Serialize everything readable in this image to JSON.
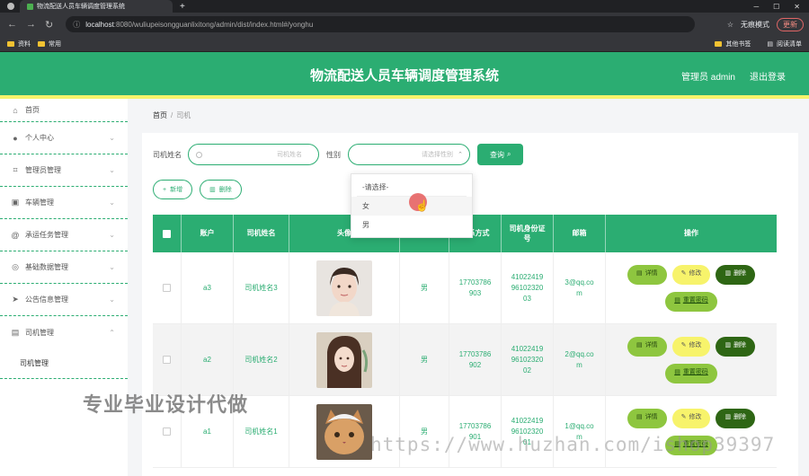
{
  "browser": {
    "tab_title": "物流配送人员车辆调度管理系统",
    "url_host": "localhost",
    "url_rest": ":8080/wuliupeisongguanlixitong/admin/dist/index.html#/yonghu",
    "incognito": "无痕模式",
    "update": "更新",
    "bookmarks": [
      "资料",
      "常用"
    ],
    "bookmarks_right": [
      "其他书签",
      "阅读清单"
    ]
  },
  "header": {
    "title": "物流配送人员车辆调度管理系统",
    "admin": "管理员 admin",
    "logout": "退出登录"
  },
  "sidebar": {
    "items": [
      {
        "label": "首页",
        "icon": "home-icon"
      },
      {
        "label": "个人中心",
        "icon": "user-icon"
      },
      {
        "label": "管理员管理",
        "icon": "crop-icon"
      },
      {
        "label": "车辆管理",
        "icon": "car-icon"
      },
      {
        "label": "承运任务管理",
        "icon": "at-icon"
      },
      {
        "label": "基础数据管理",
        "icon": "compass-icon"
      },
      {
        "label": "公告信息管理",
        "icon": "send-icon"
      },
      {
        "label": "司机管理",
        "icon": "doc-icon"
      }
    ],
    "sub": "司机管理"
  },
  "breadcrumb": {
    "home": "首页",
    "sep": "/",
    "current": "司机"
  },
  "search": {
    "name_label": "司机姓名",
    "name_placeholder": "司机姓名",
    "gender_label": "性别",
    "gender_placeholder": "请选择性别",
    "query": "查询"
  },
  "actions": {
    "add": "新增",
    "delete": "删除"
  },
  "dropdown": [
    "-请选择-",
    "女",
    "男"
  ],
  "table": {
    "headers": [
      "账户",
      "司机姓名",
      "头像",
      "性别",
      "联系方式",
      "司机身份证号",
      "邮箱",
      "操作"
    ],
    "rows": [
      {
        "account": "a3",
        "name": "司机姓名3",
        "gender": "男",
        "phone1": "17703786",
        "phone2": "903",
        "id1": "41022419",
        "id2": "96102320",
        "id3": "03",
        "email1": "3@qq.co",
        "email2": "m"
      },
      {
        "account": "a2",
        "name": "司机姓名2",
        "gender": "男",
        "phone1": "17703786",
        "phone2": "902",
        "id1": "41022419",
        "id2": "96102320",
        "id3": "02",
        "email1": "2@qq.co",
        "email2": "m"
      },
      {
        "account": "a1",
        "name": "司机姓名1",
        "gender": "男",
        "phone1": "17703786",
        "phone2": "901",
        "id1": "41022419",
        "id2": "96102320",
        "id3": "01",
        "email1": "1@qq.co",
        "email2": "m"
      }
    ],
    "ops": {
      "detail": "详情",
      "edit": "修改",
      "del": "删除",
      "reset": "重置密码"
    }
  },
  "watermarks": {
    "cn": "专业毕业设计代做",
    "url": "https://www.huzhan.com/ishop39397"
  }
}
